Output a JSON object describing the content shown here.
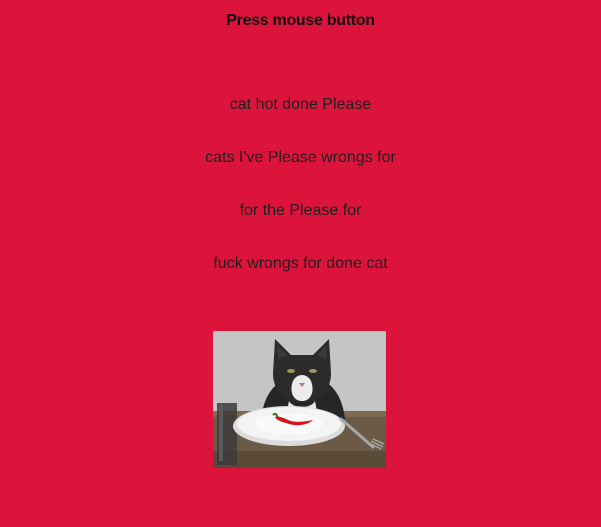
{
  "header": {
    "title": "Press mouse button"
  },
  "poem": {
    "lines": [
      "cat hot done Please",
      "cats I've Please wrongs for",
      "for the Please for",
      "fuck wrongs for done cat"
    ]
  },
  "image": {
    "subject": "cat-at-table-with-chili-on-plate",
    "colors": {
      "background": "#dc143c",
      "wall": "#c8c8c8",
      "table": "#6b5a45",
      "plate": "#f2f2f2",
      "chili": "#d01818",
      "cat_fur": "#2a2a2a",
      "cat_white": "#ededed"
    }
  }
}
